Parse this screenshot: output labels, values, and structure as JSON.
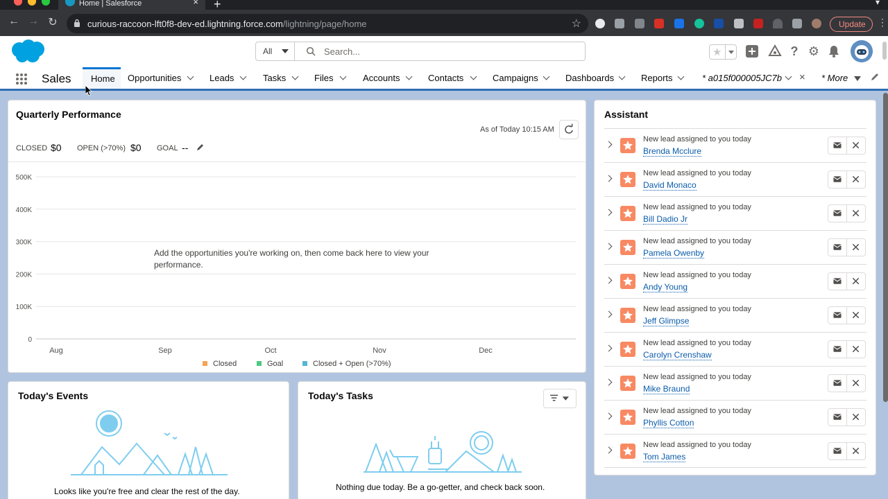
{
  "browser": {
    "tab_title": "Home | Salesforce",
    "url_host": "curious-raccoon-lft0f8-dev-ed.lightning.force.com",
    "url_path": "/lightning/page/home",
    "update_label": "Update"
  },
  "header": {
    "search_scope": "All",
    "search_placeholder": "Search..."
  },
  "nav": {
    "app_name": "Sales",
    "items": [
      {
        "label": "Home"
      },
      {
        "label": "Opportunities"
      },
      {
        "label": "Leads"
      },
      {
        "label": "Tasks"
      },
      {
        "label": "Files"
      },
      {
        "label": "Accounts"
      },
      {
        "label": "Contacts"
      },
      {
        "label": "Campaigns"
      },
      {
        "label": "Dashboards"
      },
      {
        "label": "Reports"
      }
    ],
    "record_tab": "* a015f000005JC7b",
    "more": "* More"
  },
  "performance": {
    "title": "Quarterly Performance",
    "as_of": "As of Today 10:15 AM",
    "closed_label": "CLOSED",
    "closed_value": "$0",
    "open_label": "OPEN (>70%)",
    "open_value": "$0",
    "goal_label": "GOAL",
    "goal_value": "--",
    "empty_message": "Add the opportunities you're working on, then come back here to view your performance."
  },
  "chart_data": {
    "type": "line",
    "y_ticks": [
      "500K",
      "400K",
      "300K",
      "200K",
      "100K",
      "0"
    ],
    "x_ticks": [
      "Aug",
      "Sep",
      "Oct",
      "Nov",
      "Dec"
    ],
    "ylim": [
      0,
      500000
    ],
    "grid": true,
    "legend_position": "bottom",
    "series": [
      {
        "name": "Closed",
        "color": "#f4a456",
        "values": []
      },
      {
        "name": "Goal",
        "color": "#4bca81",
        "values": []
      },
      {
        "name": "Closed + Open (>70%)",
        "color": "#54b6d6",
        "values": []
      }
    ]
  },
  "events": {
    "title": "Today's Events",
    "empty_message": "Looks like you're free and clear the rest of the day."
  },
  "tasks": {
    "title": "Today's Tasks",
    "empty_message": "Nothing due today. Be a go-getter, and check back soon."
  },
  "assistant": {
    "title": "Assistant",
    "items": [
      {
        "subtitle": "New lead assigned to you today",
        "name": "Brenda Mcclure"
      },
      {
        "subtitle": "New lead assigned to you today",
        "name": "David Monaco"
      },
      {
        "subtitle": "New lead assigned to you today",
        "name": "Bill Dadio Jr"
      },
      {
        "subtitle": "New lead assigned to you today",
        "name": "Pamela Owenby"
      },
      {
        "subtitle": "New lead assigned to you today",
        "name": "Andy Young"
      },
      {
        "subtitle": "New lead assigned to you today",
        "name": "Jeff Glimpse"
      },
      {
        "subtitle": "New lead assigned to you today",
        "name": "Carolyn Crenshaw"
      },
      {
        "subtitle": "New lead assigned to you today",
        "name": "Mike Braund"
      },
      {
        "subtitle": "New lead assigned to you today",
        "name": "Phyllis Cotton"
      },
      {
        "subtitle": "New lead assigned to you today",
        "name": "Tom James"
      }
    ]
  }
}
